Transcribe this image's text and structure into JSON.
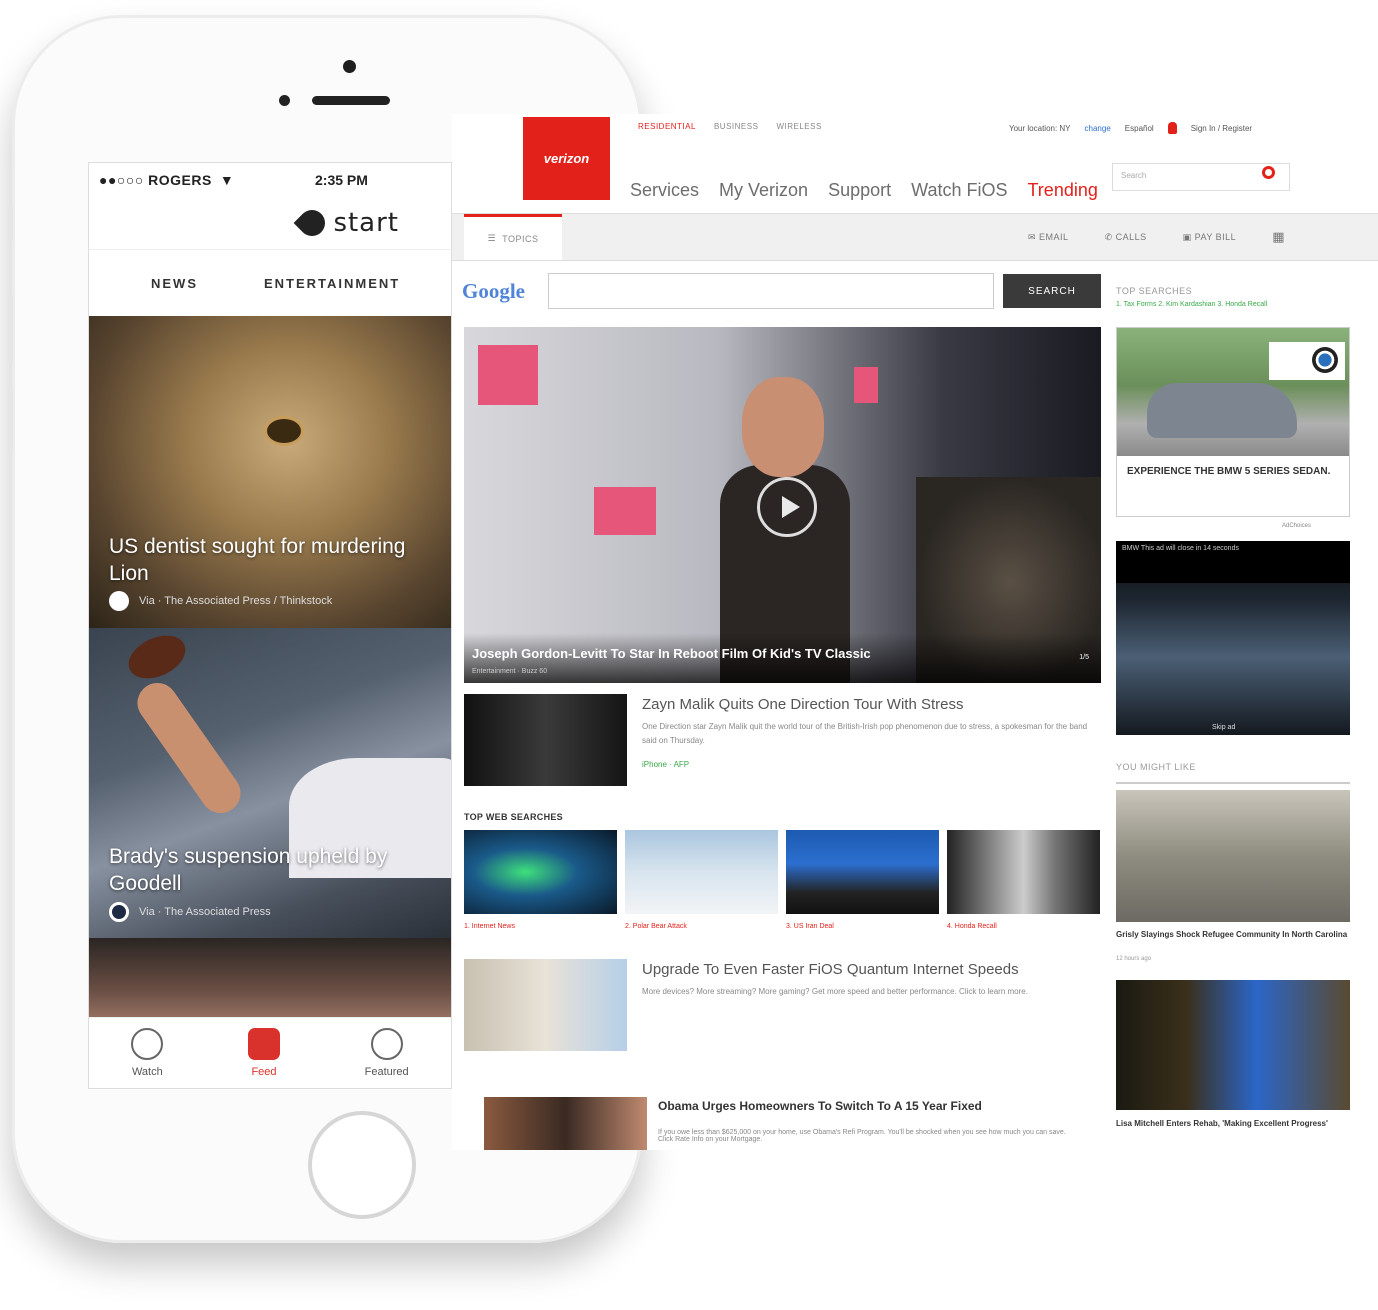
{
  "phone": {
    "status": {
      "carrier": "●●○○○ ROGERS",
      "time": "2:35 PM"
    },
    "app_name": "start",
    "tabs": [
      "NEWS",
      "ENTERTAINMENT"
    ],
    "cards": [
      {
        "title_line1": "US dentist sought for murdering",
        "title_line2": "Lion",
        "meta": "Via · The Associated Press / Thinkstock"
      },
      {
        "title_line1": "Brady's suspension upheld by",
        "title_line2": "Goodell",
        "meta": "Via · The Associated Press"
      }
    ],
    "bottom_nav": [
      {
        "label": "Watch"
      },
      {
        "label": "Feed"
      },
      {
        "label": "Featured"
      }
    ]
  },
  "desktop": {
    "logo_text": "verizon",
    "top_links": [
      "RESIDENTIAL",
      "BUSINESS",
      "WIRELESS"
    ],
    "utility": {
      "location": "Your location: NY",
      "change": "change",
      "language": "Español",
      "sign_in": "Sign In / Register"
    },
    "main_nav": [
      "Services",
      "My Verizon",
      "Support",
      "Watch FiOS",
      "Trending"
    ],
    "search_placeholder": "Search",
    "subbar": {
      "topics": "TOPICS",
      "email": "EMAIL",
      "calls": "CALLS",
      "pay_bill": "PAY BILL"
    },
    "google": {
      "logo": "Google",
      "button": "SEARCH"
    },
    "hero": {
      "title": "Joseph Gordon-Levitt To Star In Reboot Film Of Kid's TV Classic",
      "sub": "Entertainment · Buzz 60",
      "count": "1/5"
    },
    "story1": {
      "title": "Zayn Malik Quits One Direction Tour With Stress",
      "desc": "One Direction star Zayn Malik quit the world tour of the British-Irish pop phenomenon due to stress, a spokesman for the band said on Thursday.",
      "tag": "iPhone · AFP"
    },
    "top_web_searches": {
      "label": "TOP WEB SEARCHES",
      "items": [
        "1. Internet News",
        "2. Polar Bear Attack",
        "3. US Iran Deal",
        "4. Honda Recall"
      ]
    },
    "story2": {
      "title": "Upgrade To Even Faster FiOS Quantum Internet Speeds",
      "desc": "More devices? More streaming? More gaming? Get more speed and better performance. Click to learn more."
    },
    "story3": {
      "title": "Obama Urges Homeowners To Switch To A 15 Year Fixed",
      "desc": "If you owe less than $625,000 on your home, use Obama's Refi Program. You'll be shocked when you see how much you can save. Click Rate Info on your Mortgage."
    },
    "rail": {
      "top_searches_label": "TOP SEARCHES",
      "top_searches_links": "1. Tax Forms   2. Kim Kardashian   3. Honda Recall",
      "ad_text": "EXPERIENCE THE BMW 5 SERIES SEDAN.",
      "adchoices": "AdChoices",
      "video_ad_bar": "BMW This ad will close in 14 seconds",
      "video_skip": "Skip ad",
      "you_might_like": "YOU MIGHT LIKE",
      "yml1": "Grisly Slayings Shock Refugee Community In North Carolina",
      "yml1_time": "12 hours ago",
      "yml2": "Lisa Mitchell Enters Rehab, 'Making Excellent Progress'"
    }
  }
}
